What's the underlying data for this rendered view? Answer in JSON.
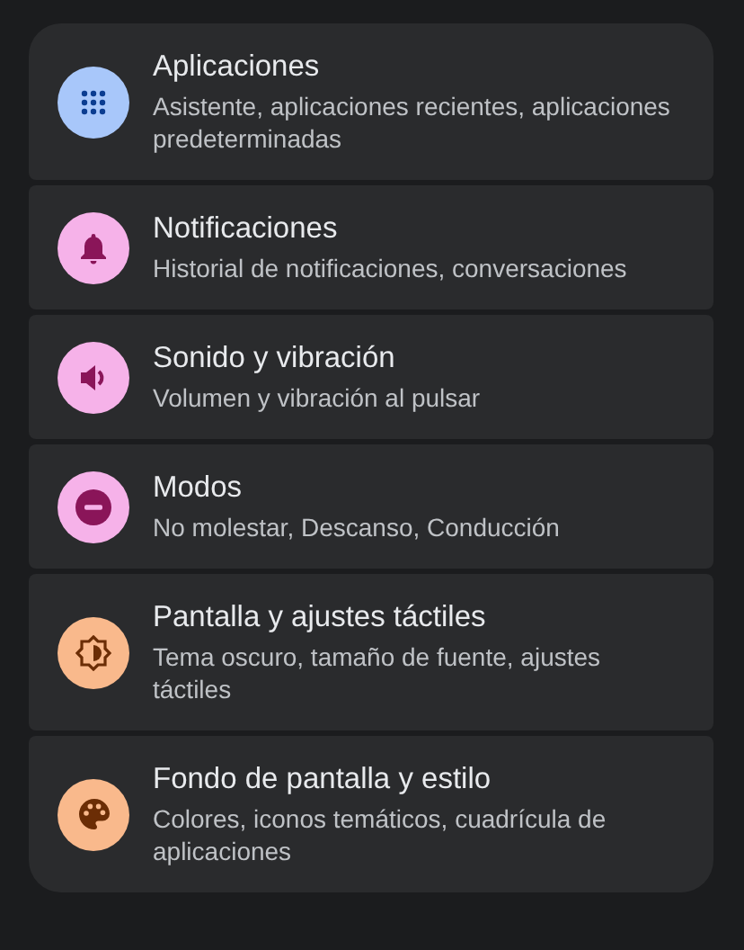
{
  "items": [
    {
      "title": "Aplicaciones",
      "subtitle": "Asistente, aplicaciones recientes, aplicaciones predeterminadas",
      "kind": "apps",
      "color": "#a8c7fa"
    },
    {
      "title": "Notificaciones",
      "subtitle": "Historial de notificaciones, conversaciones",
      "kind": "bell",
      "color": "#f6b2e9"
    },
    {
      "title": "Sonido y vibración",
      "subtitle": "Volumen y vibración al pulsar",
      "kind": "speaker",
      "color": "#f6b2e9"
    },
    {
      "title": "Modos",
      "subtitle": "No molestar, Descanso, Conducción",
      "kind": "minus",
      "color": "#f6b2e9"
    },
    {
      "title": "Pantalla y ajustes táctiles",
      "subtitle": "Tema oscuro, tamaño de fuente, ajustes táctiles",
      "kind": "brightness",
      "color": "#f9b98c"
    },
    {
      "title": "Fondo de pantalla y estilo",
      "subtitle": "Colores, iconos temáticos, cuadrícula de aplicaciones",
      "kind": "palette",
      "color": "#f9b98c"
    }
  ]
}
